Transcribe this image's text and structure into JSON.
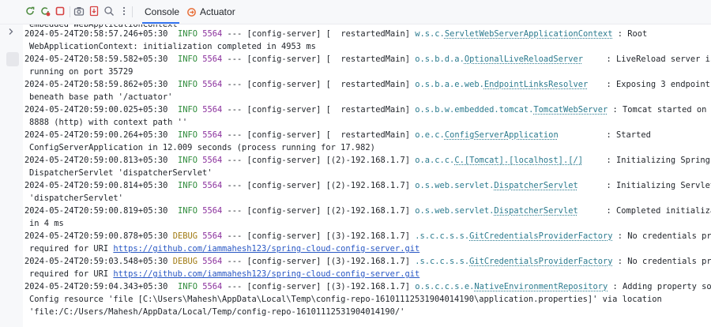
{
  "toolbar": {
    "tabs": [
      {
        "label": "Console"
      },
      {
        "label": "Actuator"
      }
    ]
  },
  "log": [
    {
      "text": "embedded WebApplicationContext"
    },
    {
      "ts": "2024-05-24T20:58:57.246+05:30",
      "level": "INFO",
      "pid": "5564",
      "meta": "--- [config-server] [  restartedMain]",
      "logger_prefix": "w.s.c.",
      "logger_name": "ServletWebServerApplicationContext",
      "msg": ": Root"
    },
    {
      "text": "WebApplicationContext: initialization completed in 4953 ms"
    },
    {
      "ts": "2024-05-24T20:58:59.582+05:30",
      "level": "INFO",
      "pid": "5564",
      "meta": "--- [config-server] [  restartedMain]",
      "logger_prefix": "o.s.b.d.a.",
      "logger_name": "OptionalLiveReloadServer",
      "msg": ": LiveReload server is"
    },
    {
      "text": "running on port 35729"
    },
    {
      "ts": "2024-05-24T20:58:59.862+05:30",
      "level": "INFO",
      "pid": "5564",
      "meta": "--- [config-server] [  restartedMain]",
      "logger_prefix": "o.s.b.a.e.web.",
      "logger_name": "EndpointLinksResolver",
      "msg": ": Exposing 3 endpoint(s)"
    },
    {
      "text": "beneath base path '/actuator'"
    },
    {
      "ts": "2024-05-24T20:59:00.025+05:30",
      "level": "INFO",
      "pid": "5564",
      "meta": "--- [config-server] [  restartedMain]",
      "logger_prefix": "o.s.b.w.embedded.tomcat.",
      "logger_name": "TomcatWebServer",
      "msg": ": Tomcat started on port"
    },
    {
      "text": "8888 (http) with context path ''"
    },
    {
      "ts": "2024-05-24T20:59:00.264+05:30",
      "level": "INFO",
      "pid": "5564",
      "meta": "--- [config-server] [  restartedMain]",
      "logger_prefix": "o.e.c.",
      "logger_name": "ConfigServerApplication",
      "msg": ": Started"
    },
    {
      "text": "ConfigServerApplication in 12.009 seconds (process running for 17.982)"
    },
    {
      "ts": "2024-05-24T20:59:00.813+05:30",
      "level": "INFO",
      "pid": "5564",
      "meta": "--- [config-server] [(2)-192.168.1.7]",
      "logger_prefix": "o.a.c.c.",
      "logger_name": "C.[Tomcat].[localhost].[/]",
      "msg": ": Initializing Spring"
    },
    {
      "text": "DispatcherServlet 'dispatcherServlet'"
    },
    {
      "ts": "2024-05-24T20:59:00.814+05:30",
      "level": "INFO",
      "pid": "5564",
      "meta": "--- [config-server] [(2)-192.168.1.7]",
      "logger_prefix": "o.s.web.servlet.",
      "logger_name": "DispatcherServlet",
      "msg": ": Initializing Servlet"
    },
    {
      "text": "'dispatcherServlet'"
    },
    {
      "ts": "2024-05-24T20:59:00.819+05:30",
      "level": "INFO",
      "pid": "5564",
      "meta": "--- [config-server] [(2)-192.168.1.7]",
      "logger_prefix": "o.s.web.servlet.",
      "logger_name": "DispatcherServlet",
      "msg": ": Completed initialization"
    },
    {
      "text": "in 4 ms"
    },
    {
      "ts": "2024-05-24T20:59:00.878+05:30",
      "level": "DEBUG",
      "pid": "5564",
      "meta": "--- [config-server] [(3)-192.168.1.7]",
      "logger_prefix": ".s.c.c.s.s.",
      "logger_name": "GitCredentialsProviderFactory",
      "msg": ": No credentials provider"
    },
    {
      "text": "required for URI",
      "url": "https://github.com/iammahesh123/spring-cloud-config-server.git"
    },
    {
      "ts": "2024-05-24T20:59:03.548+05:30",
      "level": "DEBUG",
      "pid": "5564",
      "meta": "--- [config-server] [(3)-192.168.1.7]",
      "logger_prefix": ".s.c.c.s.s.",
      "logger_name": "GitCredentialsProviderFactory",
      "msg": ": No credentials provider"
    },
    {
      "text": "required for URI",
      "url": "https://github.com/iammahesh123/spring-cloud-config-server.git"
    },
    {
      "ts": "2024-05-24T20:59:04.343+05:30",
      "level": "INFO",
      "pid": "5564",
      "meta": "--- [config-server] [(3)-192.168.1.7]",
      "logger_prefix": "o.s.c.c.s.e.",
      "logger_name": "NativeEnvironmentRepository",
      "msg": ": Adding property source:"
    },
    {
      "text": "Config resource 'file [C:\\Users\\Mahesh\\AppData\\Local\\Temp\\config-repo-16101112531904014190\\application.properties]' via location"
    },
    {
      "text": "'file:/C:/Users/Mahesh/AppData/Local/Temp/config-repo-16101112531904014190/'"
    }
  ]
}
